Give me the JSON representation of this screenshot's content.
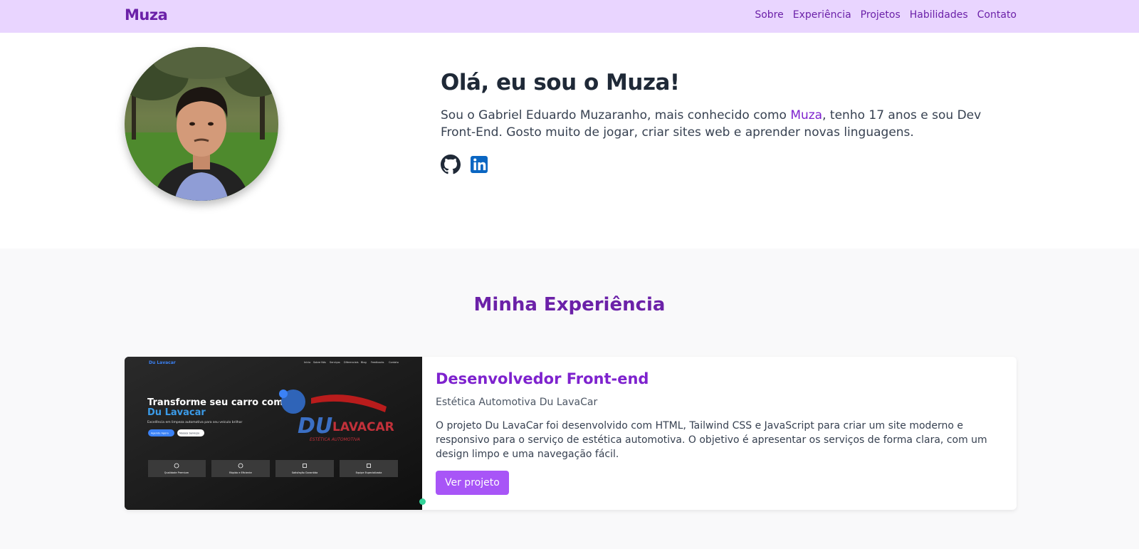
{
  "nav": {
    "brand": "Muza",
    "links": [
      "Sobre",
      "Experiência",
      "Projetos",
      "Habilidades",
      "Contato"
    ]
  },
  "hero": {
    "title": "Olá, eu sou o Muza!",
    "intro_before": "Sou o Gabriel Eduardo Muzaranho, mais conhecido como ",
    "intro_accent": "Muza",
    "intro_after": ", tenho 17 anos e sou Dev Front-End. Gosto muito de jogar, criar sites web e aprender novas linguagens.",
    "socials": [
      "github-icon",
      "linkedin-icon"
    ]
  },
  "experience": {
    "heading": "Minha Experiência",
    "items": [
      {
        "role": "Desenvolvedor Front-end",
        "company": "Estética Automotiva Du LavaCar",
        "description": "O projeto Du LavaCar foi desenvolvido com HTML, Tailwind CSS e JavaScript para criar um site moderno e responsivo para o serviço de estética automotiva. O objetivo é apresentar os serviços de forma clara, com um design limpo e uma navegação fácil.",
        "button": "Ver projeto",
        "screenshot": {
          "brand": "Du Lavacar",
          "nav": [
            "Início",
            "Sobre Nós",
            "Serviços",
            "Diferenciais",
            "Blog",
            "Feedbacks",
            "Contato"
          ],
          "headline_1": "Transforme seu carro com",
          "headline_2": "Du Lavacar",
          "tagline": "Excelência em limpeza automotiva para seu veículo brilhar",
          "cta_primary": "Agende Agora",
          "cta_secondary": "Nossos Serviços",
          "logo_du": "DU",
          "logo_lavacar": "LAVACAR",
          "logo_sub": "ESTÉTICA AUTOMOTIVA",
          "features": [
            "Qualidade Premium",
            "Rápido e Eficiente",
            "Satisfação Garantida",
            "Equipe Especializada"
          ]
        }
      }
    ]
  },
  "colors": {
    "nav_bg": "#e9d5ff",
    "brand": "#6b21a8",
    "accent": "#7e22ce",
    "button": "#a855f7",
    "linkedin": "#0a66c2"
  }
}
